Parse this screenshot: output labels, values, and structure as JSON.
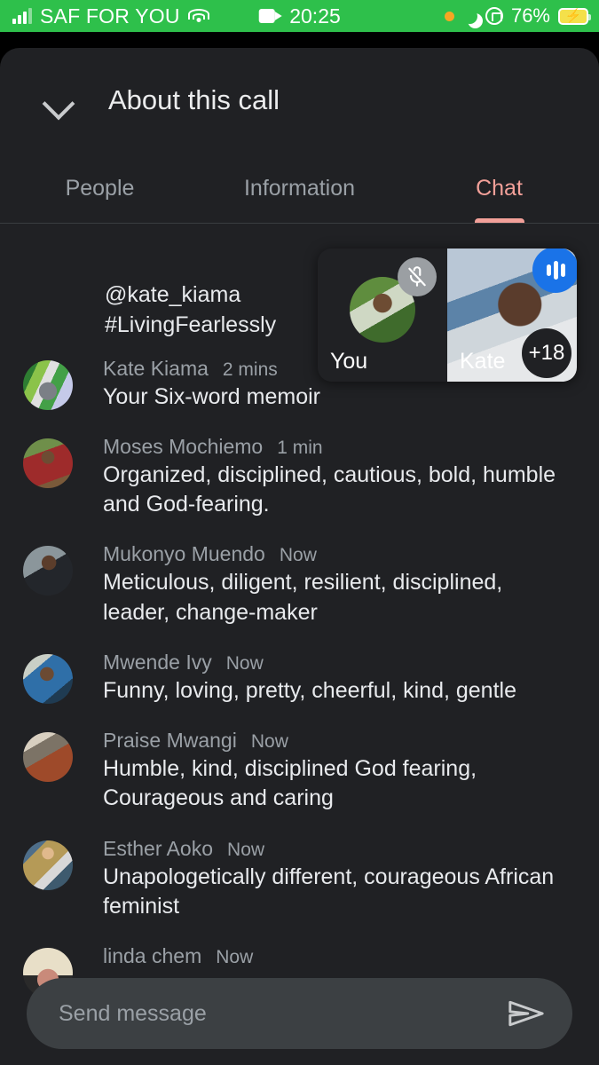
{
  "status_bar": {
    "carrier": "SAF FOR YOU",
    "time": "20:25",
    "battery_percent": "76%",
    "background_color": "#2ec04b",
    "icons": [
      "signal-bars-icon",
      "wifi-icon",
      "screen-record-camera-icon",
      "orange-privacy-dot-icon",
      "do-not-disturb-moon-icon",
      "rotation-lock-icon",
      "battery-charging-icon"
    ]
  },
  "panel": {
    "title": "About this call",
    "collapse_icon": "chevron-down-icon",
    "accent_color": "#f2a099",
    "tabs": [
      {
        "label": "People",
        "active": false
      },
      {
        "label": "Information",
        "active": false
      },
      {
        "label": "Chat",
        "active": true
      }
    ]
  },
  "pinned_message": {
    "handle": "@kate_kiama",
    "hashtag": "#LivingFearlessly"
  },
  "messages": [
    {
      "author": "Kate Kiama",
      "time": "2 mins",
      "text": "Your Six-word memoir",
      "avatar": "ph-kate"
    },
    {
      "author": "Moses Mochiemo",
      "time": "1 min",
      "text": "Organized, disciplined, cautious, bold, humble and God-fearing.",
      "avatar": "ph-moses"
    },
    {
      "author": "Mukonyo Muendo",
      "time": "Now",
      "text": "Meticulous, diligent, resilient, disciplined, leader, change-maker",
      "avatar": "ph-mukonyo"
    },
    {
      "author": "Mwende Ivy",
      "time": "Now",
      "text": "Funny, loving, pretty, cheerful, kind, gentle",
      "avatar": "ph-mwende"
    },
    {
      "author": "Praise Mwangi",
      "time": "Now",
      "text": "Humble, kind, disciplined God fearing, Courageous and caring",
      "avatar": "ph-praise"
    },
    {
      "author": "Esther Aoko",
      "time": "Now",
      "text": "Unapologetically different, courageous African feminist",
      "avatar": "ph-esther"
    },
    {
      "author": "linda chem",
      "time": "Now",
      "text": "",
      "avatar": "ph-linda"
    }
  ],
  "video_overlay": {
    "self_tile": {
      "name": "You",
      "mic_state": "muted",
      "mic_icon": "mic-off-icon"
    },
    "speaker_tile": {
      "name": "Kate",
      "speaking_icon": "audio-levels-icon",
      "speaking_color": "#1a73e8",
      "overflow_badge": "+18"
    }
  },
  "composer": {
    "placeholder": "Send message",
    "value": "",
    "send_icon": "send-paper-plane-icon"
  }
}
